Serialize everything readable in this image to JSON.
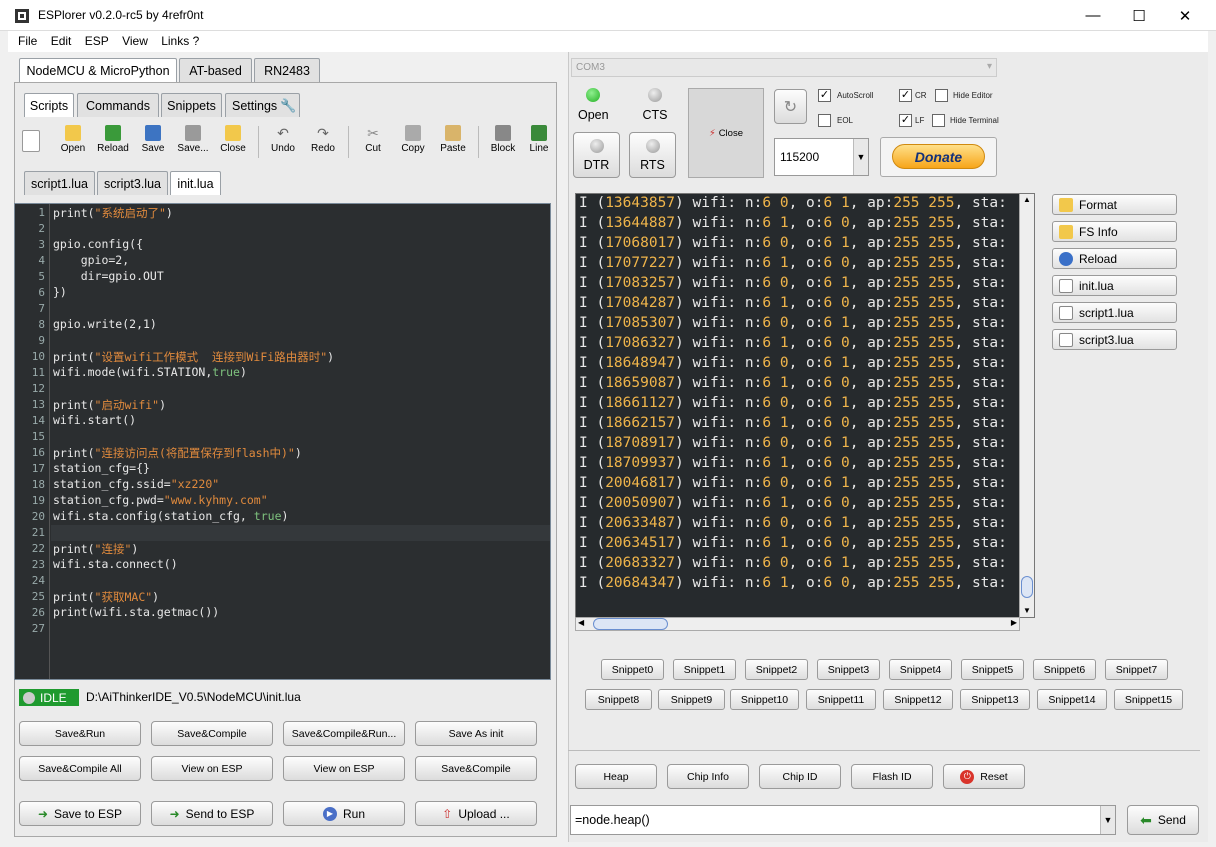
{
  "window": {
    "title": "ESPlorer v0.2.0-rc5 by 4refr0nt"
  },
  "menu": [
    "File",
    "Edit",
    "ESP",
    "View",
    "Links ?"
  ],
  "top_tabs": [
    "NodeMCU & MicroPython",
    "AT-based",
    "RN2483"
  ],
  "sub_tabs": [
    "Scripts",
    "Commands",
    "Snippets",
    "Settings"
  ],
  "toolbar": [
    "Open",
    "Reload",
    "Save",
    "Save...",
    "Close",
    "Undo",
    "Redo",
    "Cut",
    "Copy",
    "Paste",
    "Block",
    "Line"
  ],
  "file_tabs": [
    "script1.lua",
    "script3.lua",
    "init.lua"
  ],
  "editor": {
    "lines": [
      [
        [
          "t",
          "print("
        ],
        [
          "s",
          "\"系统启动了\""
        ],
        [
          "t",
          ")"
        ]
      ],
      [],
      [
        [
          "t",
          "gpio.config({"
        ]
      ],
      [
        [
          "t",
          "    gpio=2,"
        ]
      ],
      [
        [
          "t",
          "    dir=gpio.OUT"
        ]
      ],
      [
        [
          "t",
          "})"
        ]
      ],
      [],
      [
        [
          "t",
          "gpio.write(2,1)"
        ]
      ],
      [],
      [
        [
          "t",
          "print("
        ],
        [
          "s",
          "\"设置wifi工作模式  连接到WiFi路由器时\""
        ],
        [
          "t",
          ")"
        ]
      ],
      [
        [
          "t",
          "wifi.mode(wifi.STATION,"
        ],
        [
          "k",
          "true"
        ],
        [
          "t",
          ")"
        ]
      ],
      [],
      [
        [
          "t",
          "print("
        ],
        [
          "s",
          "\"启动wifi\""
        ],
        [
          "t",
          ")"
        ]
      ],
      [
        [
          "t",
          "wifi.start()"
        ]
      ],
      [],
      [
        [
          "t",
          "print("
        ],
        [
          "s",
          "\"连接访问点(将配置保存到flash中)\""
        ],
        [
          "t",
          ")"
        ]
      ],
      [
        [
          "t",
          "station_cfg={}"
        ]
      ],
      [
        [
          "t",
          "station_cfg.ssid="
        ],
        [
          "s",
          "\"xz220\""
        ]
      ],
      [
        [
          "t",
          "station_cfg.pwd="
        ],
        [
          "s",
          "\"www.kyhmy.com\""
        ]
      ],
      [
        [
          "t",
          "wifi.sta.config(station_cfg, "
        ],
        [
          "k",
          "true"
        ],
        [
          "t",
          ")"
        ]
      ],
      [],
      [
        [
          "t",
          "print("
        ],
        [
          "s",
          "\"连接\""
        ],
        [
          "t",
          ")"
        ]
      ],
      [
        [
          "t",
          "wifi.sta.connect()"
        ]
      ],
      [],
      [
        [
          "t",
          "print("
        ],
        [
          "s",
          "\"获取MAC\""
        ],
        [
          "t",
          ")"
        ]
      ],
      [
        [
          "t",
          "print(wifi.sta.getmac())"
        ]
      ],
      []
    ]
  },
  "status": {
    "state": "IDLE",
    "path": "D:\\AiThinkerIDE_V0.5\\NodeMCU\\init.lua"
  },
  "left_buttons": [
    "Save&Run",
    "Save&Compile",
    "Save&Compile&Run...",
    "Save As init",
    "Save&Compile All",
    "View on ESP",
    "View on ESP",
    "Save&Compile"
  ],
  "bottom_buttons": [
    "Save to ESP",
    "Send to ESP",
    "Run",
    "Upload ..."
  ],
  "port": {
    "value": "COM3"
  },
  "conn": {
    "open": "Open",
    "cts": "CTS",
    "dtr": "DTR",
    "rts": "RTS",
    "close": "Close",
    "baud": "115200",
    "donate": "Donate"
  },
  "checks": {
    "autoscroll": "AutoScroll",
    "eol": "EOL",
    "cr": "CR",
    "lf": "LF",
    "hide_editor": "Hide Editor",
    "hide_terminal": "Hide Terminal"
  },
  "terminal": [
    [
      "13643857",
      "0",
      "6",
      "1"
    ],
    [
      "13644887",
      "1",
      "6",
      "0"
    ],
    [
      "17068017",
      "0",
      "6",
      "1"
    ],
    [
      "17077227",
      "1",
      "6",
      "0"
    ],
    [
      "17083257",
      "0",
      "6",
      "1"
    ],
    [
      "17084287",
      "1",
      "6",
      "0"
    ],
    [
      "17085307",
      "0",
      "6",
      "1"
    ],
    [
      "17086327",
      "1",
      "6",
      "0"
    ],
    [
      "18648947",
      "0",
      "6",
      "1"
    ],
    [
      "18659087",
      "1",
      "6",
      "0"
    ],
    [
      "18661127",
      "0",
      "6",
      "1"
    ],
    [
      "18662157",
      "1",
      "6",
      "0"
    ],
    [
      "18708917",
      "0",
      "6",
      "1"
    ],
    [
      "18709937",
      "1",
      "6",
      "0"
    ],
    [
      "20046817",
      "0",
      "6",
      "1"
    ],
    [
      "20050907",
      "1",
      "6",
      "0"
    ],
    [
      "20633487",
      "0",
      "6",
      "1"
    ],
    [
      "20634517",
      "1",
      "6",
      "0"
    ],
    [
      "20683327",
      "0",
      "6",
      "1"
    ],
    [
      "20684347",
      "1",
      "6",
      "0"
    ]
  ],
  "right_panel": [
    "Format",
    "FS Info",
    "Reload",
    "init.lua",
    "script1.lua",
    "script3.lua"
  ],
  "snippets": [
    "Snippet0",
    "Snippet1",
    "Snippet2",
    "Snippet3",
    "Snippet4",
    "Snippet5",
    "Snippet6",
    "Snippet7",
    "Snippet8",
    "Snippet9",
    "Snippet10",
    "Snippet11",
    "Snippet12",
    "Snippet13",
    "Snippet14",
    "Snippet15"
  ],
  "bottom_right": [
    "Heap",
    "Chip Info",
    "Chip ID",
    "Flash ID",
    "Reset"
  ],
  "command": {
    "value": "=node.heap()",
    "send": "Send"
  },
  "colors": {
    "editor_bg": "#2b2e30",
    "string": "#e08a3d",
    "keyword": "#7ec27e",
    "terminal_num": "#f0b54b",
    "idle_green": "#1f9a2f"
  }
}
